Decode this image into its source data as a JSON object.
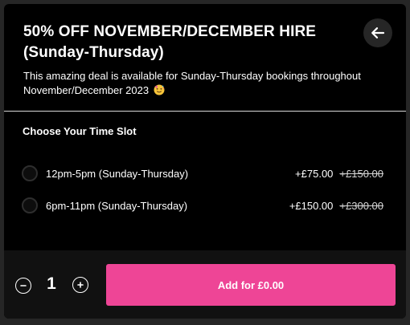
{
  "header": {
    "title": "50% OFF NOVEMBER/DECEMBER HIRE (Sunday-Thursday)",
    "subtitle": "This amazing deal is available for Sunday-Thursday bookings throughout November/December 2023",
    "emoji": "party-face-icon",
    "back_icon": "arrow-left-icon"
  },
  "time_slots": {
    "section_title": "Choose Your Time Slot",
    "options": [
      {
        "label": "12pm-5pm (Sunday-Thursday)",
        "price": "+£75.00",
        "old_price": "+£150.00",
        "selected": false
      },
      {
        "label": "6pm-11pm (Sunday-Thursday)",
        "price": "+£150.00",
        "old_price": "+£300.00",
        "selected": false
      }
    ]
  },
  "footer": {
    "quantity": "1",
    "decrement_icon": "minus-icon",
    "increment_icon": "plus-icon",
    "add_label": "Add for £0.00"
  },
  "colors": {
    "accent": "#ee4596",
    "background": "#000000",
    "footer_bg": "#111111"
  }
}
